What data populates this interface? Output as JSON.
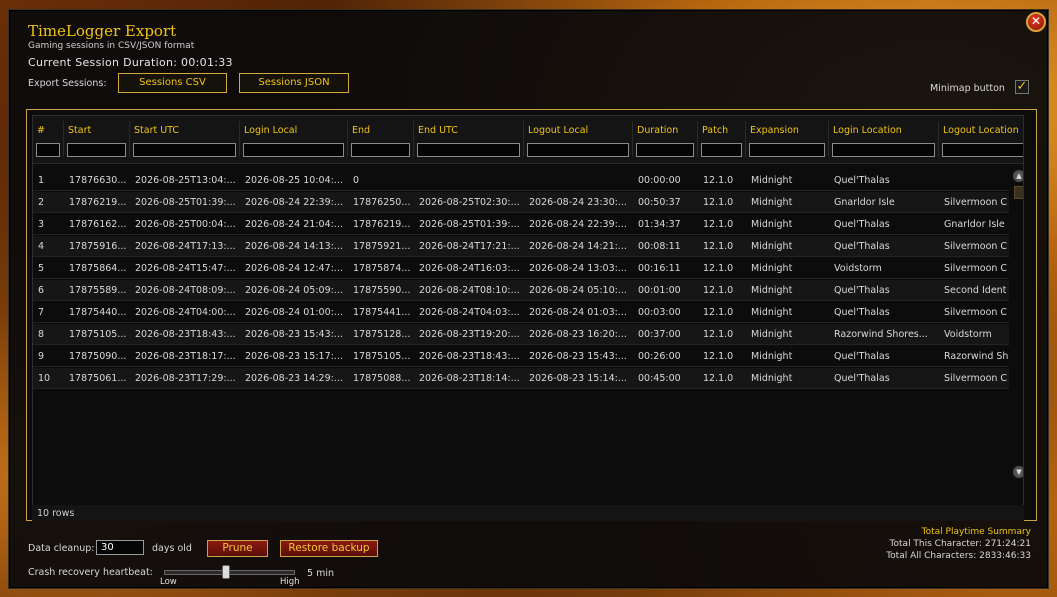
{
  "window": {
    "title": "TimeLogger Export",
    "subtitle": "Gaming sessions in CSV/JSON format",
    "session_duration": "Current Session Duration: 00:01:33",
    "close_glyph": "✕"
  },
  "export": {
    "label": "Export Sessions:",
    "csv_button": "Sessions CSV",
    "json_button": "Sessions JSON"
  },
  "minimap": {
    "label": "Minimap button",
    "checked": true,
    "check_glyph": "✓"
  },
  "table": {
    "columns": [
      "#",
      "Start",
      "Start UTC",
      "Login Local",
      "End",
      "End UTC",
      "Logout Local",
      "Duration",
      "Patch",
      "Expansion",
      "Login Location",
      "Logout Location"
    ],
    "rows": [
      [
        "1",
        "17876630...",
        "2026-08-25T13:04:...",
        "2026-08-25 10:04:...",
        "0",
        "",
        "",
        "00:00:00",
        "12.1.0",
        "Midnight",
        "Quel'Thalas",
        ""
      ],
      [
        "2",
        "17876219...",
        "2026-08-25T01:39:...",
        "2026-08-24 22:39:...",
        "17876250...",
        "2026-08-25T02:30:...",
        "2026-08-24 23:30:...",
        "00:50:37",
        "12.1.0",
        "Midnight",
        "Gnarldor Isle",
        "Silvermoon C"
      ],
      [
        "3",
        "17876162...",
        "2026-08-25T00:04:...",
        "2026-08-24 21:04:...",
        "17876219...",
        "2026-08-25T01:39:...",
        "2026-08-24 22:39:...",
        "01:34:37",
        "12.1.0",
        "Midnight",
        "Quel'Thalas",
        "Gnarldor Isle"
      ],
      [
        "4",
        "17875916...",
        "2026-08-24T17:13:...",
        "2026-08-24 14:13:...",
        "17875921...",
        "2026-08-24T17:21:...",
        "2026-08-24 14:21:...",
        "00:08:11",
        "12.1.0",
        "Midnight",
        "Quel'Thalas",
        "Silvermoon C"
      ],
      [
        "5",
        "17875864...",
        "2026-08-24T15:47:...",
        "2026-08-24 12:47:...",
        "17875874...",
        "2026-08-24T16:03:...",
        "2026-08-24 13:03:...",
        "00:16:11",
        "12.1.0",
        "Midnight",
        "Voidstorm",
        "Silvermoon C"
      ],
      [
        "6",
        "17875589...",
        "2026-08-24T08:09:...",
        "2026-08-24 05:09:...",
        "17875590...",
        "2026-08-24T08:10:...",
        "2026-08-24 05:10:...",
        "00:01:00",
        "12.1.0",
        "Midnight",
        "Quel'Thalas",
        "Second Ident"
      ],
      [
        "7",
        "17875440...",
        "2026-08-24T04:00:...",
        "2026-08-24 01:00:...",
        "17875441...",
        "2026-08-24T04:03:...",
        "2026-08-24 01:03:...",
        "00:03:00",
        "12.1.0",
        "Midnight",
        "Quel'Thalas",
        "Silvermoon C"
      ],
      [
        "8",
        "17875105...",
        "2026-08-23T18:43:...",
        "2026-08-23 15:43:...",
        "17875128...",
        "2026-08-23T19:20:...",
        "2026-08-23 16:20:...",
        "00:37:00",
        "12.1.0",
        "Midnight",
        "Razorwind Shores...",
        "Voidstorm"
      ],
      [
        "9",
        "17875090...",
        "2026-08-23T18:17:...",
        "2026-08-23 15:17:...",
        "17875105...",
        "2026-08-23T18:43:...",
        "2026-08-23 15:43:...",
        "00:26:00",
        "12.1.0",
        "Midnight",
        "Quel'Thalas",
        "Razorwind Sh"
      ],
      [
        "10",
        "17875061...",
        "2026-08-23T17:29:...",
        "2026-08-23 14:29:...",
        "17875088...",
        "2026-08-23T18:14:...",
        "2026-08-23 15:14:...",
        "00:45:00",
        "12.1.0",
        "Midnight",
        "Quel'Thalas",
        "Silvermoon C"
      ]
    ],
    "row_count": "10 rows"
  },
  "cleanup": {
    "label": "Data cleanup:",
    "days_value": "30",
    "days_label": "days old",
    "prune_button": "Prune",
    "restore_button": "Restore backup"
  },
  "heartbeat": {
    "label": "Crash recovery heartbeat:",
    "low": "Low",
    "high": "High",
    "value": "5 min",
    "level_fraction": 0.47
  },
  "summary": {
    "title": "Total Playtime Summary",
    "this_character": "Total This Character: 271:24:21",
    "all_characters": "Total All Characters: 2833:46:33"
  },
  "colors": {
    "accent_gold": "#f0c419",
    "button_red": "#8c1a10",
    "panel_border": "#c9a24a"
  }
}
